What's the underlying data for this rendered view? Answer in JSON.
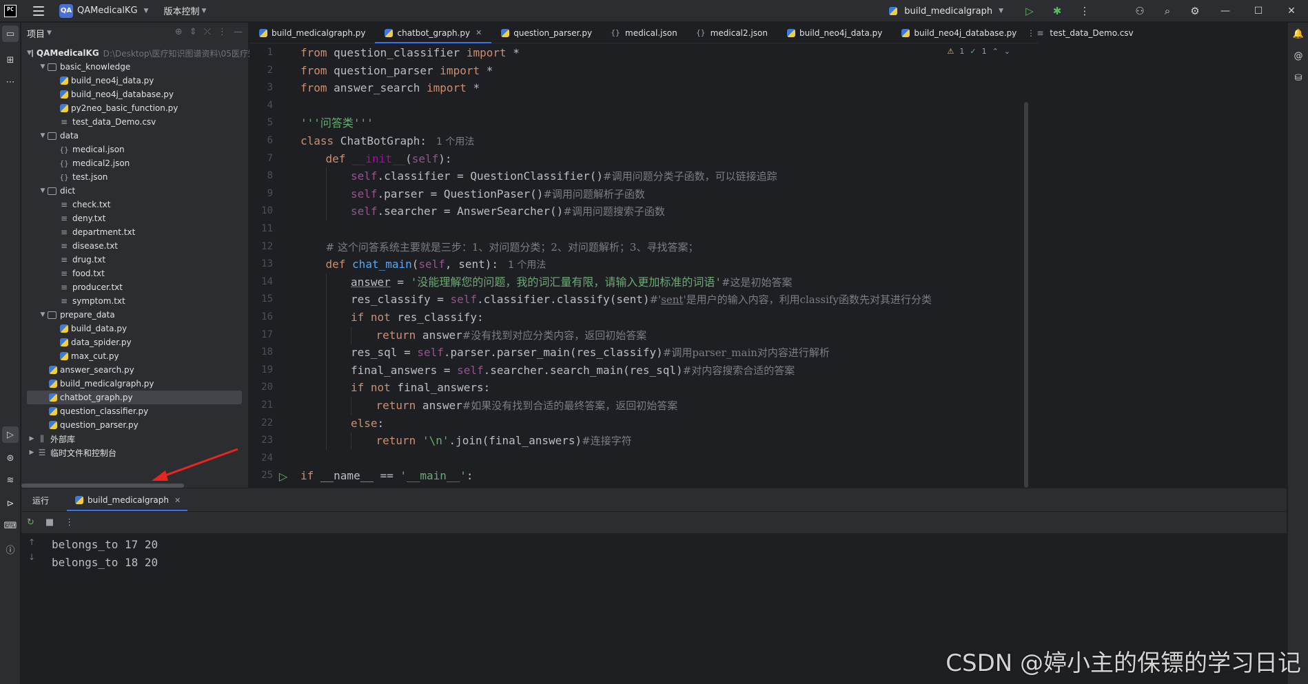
{
  "titlebar": {
    "logo": "PC",
    "project_badge": "QA",
    "project_name": "QAMedicalKG",
    "vcs_label": "版本控制",
    "run_config": "build_medicalgraph"
  },
  "project_panel": {
    "title": "项目",
    "root_name": "QAMedicalKG",
    "root_path": "D:\\Desktop\\医疗知识图谱资料\\05医疗知识图谱",
    "tree": [
      {
        "label": "basic_knowledge",
        "type": "folder",
        "depth": 1,
        "expanded": true
      },
      {
        "label": "build_neo4j_data.py",
        "type": "py",
        "depth": 2
      },
      {
        "label": "build_neo4j_database.py",
        "type": "py",
        "depth": 2
      },
      {
        "label": "py2neo_basic_function.py",
        "type": "py",
        "depth": 2
      },
      {
        "label": "test_data_Demo.csv",
        "type": "txt",
        "depth": 2
      },
      {
        "label": "data",
        "type": "folder",
        "depth": 1,
        "expanded": true
      },
      {
        "label": "medical.json",
        "type": "json",
        "depth": 2
      },
      {
        "label": "medical2.json",
        "type": "json",
        "depth": 2
      },
      {
        "label": "test.json",
        "type": "json",
        "depth": 2
      },
      {
        "label": "dict",
        "type": "folder",
        "depth": 1,
        "expanded": true
      },
      {
        "label": "check.txt",
        "type": "txt",
        "depth": 2
      },
      {
        "label": "deny.txt",
        "type": "txt",
        "depth": 2
      },
      {
        "label": "department.txt",
        "type": "txt",
        "depth": 2
      },
      {
        "label": "disease.txt",
        "type": "txt",
        "depth": 2
      },
      {
        "label": "drug.txt",
        "type": "txt",
        "depth": 2
      },
      {
        "label": "food.txt",
        "type": "txt",
        "depth": 2
      },
      {
        "label": "producer.txt",
        "type": "txt",
        "depth": 2
      },
      {
        "label": "symptom.txt",
        "type": "txt",
        "depth": 2
      },
      {
        "label": "prepare_data",
        "type": "folder",
        "depth": 1,
        "expanded": true
      },
      {
        "label": "build_data.py",
        "type": "py",
        "depth": 2
      },
      {
        "label": "data_spider.py",
        "type": "py",
        "depth": 2
      },
      {
        "label": "max_cut.py",
        "type": "py",
        "depth": 2
      },
      {
        "label": "answer_search.py",
        "type": "py",
        "depth": 1
      },
      {
        "label": "build_medicalgraph.py",
        "type": "py",
        "depth": 1
      },
      {
        "label": "chatbot_graph.py",
        "type": "py",
        "depth": 1,
        "selected": true
      },
      {
        "label": "question_classifier.py",
        "type": "py",
        "depth": 1
      },
      {
        "label": "question_parser.py",
        "type": "py",
        "depth": 1
      },
      {
        "label": "外部库",
        "type": "lib",
        "depth": 0,
        "expanded": false
      },
      {
        "label": "临时文件和控制台",
        "type": "scratch",
        "depth": 0,
        "expanded": false
      }
    ]
  },
  "tabs": [
    {
      "label": "build_medicalgraph.py",
      "type": "py"
    },
    {
      "label": "chatbot_graph.py",
      "type": "py",
      "active": true
    },
    {
      "label": "question_parser.py",
      "type": "py"
    },
    {
      "label": "medical.json",
      "type": "json"
    },
    {
      "label": "medical2.json",
      "type": "json"
    },
    {
      "label": "build_neo4j_data.py",
      "type": "py"
    },
    {
      "label": "build_neo4j_database.py",
      "type": "py"
    },
    {
      "label": "test_data_Demo.csv",
      "type": "txt"
    }
  ],
  "editor": {
    "warnings": "1",
    "checks": "1",
    "run_line": 25,
    "lines": [
      {
        "n": "1",
        "indent": 0,
        "html": "<span class='k'>from</span> question_classifier <span class='k'>import</span> *"
      },
      {
        "n": "2",
        "indent": 0,
        "html": "<span class='k'>from</span> question_parser <span class='k'>import</span> *"
      },
      {
        "n": "3",
        "indent": 0,
        "html": "<span class='k'>from</span> answer_search <span class='k'>import</span> *"
      },
      {
        "n": "4",
        "indent": 0,
        "html": ""
      },
      {
        "n": "5",
        "indent": 0,
        "html": "<span class='s'>'''问答类'''</span>"
      },
      {
        "n": "6",
        "indent": 0,
        "html": "<span class='k'>class</span> ChatBotGraph:<span class='hint'>1 个用法</span>"
      },
      {
        "n": "7",
        "indent": 1,
        "html": "<span class='k'>def</span> <span class='dn'>__init__</span>(<span class='sf'>self</span>):"
      },
      {
        "n": "8",
        "indent": 2,
        "html": "<span class='sf'>self</span>.classifier = QuestionClassifier()<span class='cm'>#调用问题分类子函数，可以链接追踪</span>"
      },
      {
        "n": "9",
        "indent": 2,
        "html": "<span class='sf'>self</span>.parser = QuestionPaser()<span class='cm'>#调用问题解析子函数</span>"
      },
      {
        "n": "10",
        "indent": 2,
        "html": "<span class='sf'>self</span>.searcher = AnswerSearcher()<span class='cm'>#调用问题搜索子函数</span>"
      },
      {
        "n": "11",
        "indent": 0,
        "html": ""
      },
      {
        "n": "12",
        "indent": 1,
        "html": "<span class='cm'># 这个问答系统主要就是三步：1、对问题分类；2、对问题解析；3、寻找答案；</span>"
      },
      {
        "n": "13",
        "indent": 1,
        "html": "<span class='k'>def</span> <span class='fn'>chat_main</span>(<span class='sf'>self</span>, sent):<span class='hint'>1 个用法</span>"
      },
      {
        "n": "14",
        "indent": 2,
        "html": "<span class='ul'>answer</span> = <span class='s'>'没能理解您的问题，我的词汇量有限，请输入更加标准的词语'</span><span class='cm'>#这是初始答案</span>"
      },
      {
        "n": "15",
        "indent": 2,
        "html": "res_classify = <span class='sf'>self</span>.classifier.classify(sent)<span class='cm'>#'<span class='ul'>sent</span>'是用户的输入内容，利用classify函数先对其进行分类</span>"
      },
      {
        "n": "16",
        "indent": 2,
        "html": "<span class='k'>if not</span> res_classify:"
      },
      {
        "n": "17",
        "indent": 3,
        "html": "<span class='k'>return</span> answer<span class='cm'>#没有找到对应分类内容，返回初始答案</span>"
      },
      {
        "n": "18",
        "indent": 2,
        "html": "res_sql = <span class='sf'>self</span>.parser.parser_main(res_classify)<span class='cm'>#调用parser_main对内容进行解析</span>"
      },
      {
        "n": "19",
        "indent": 2,
        "html": "final_answers = <span class='sf'>self</span>.searcher.search_main(res_sql)<span class='cm'>#对内容搜索合适的答案</span>"
      },
      {
        "n": "20",
        "indent": 2,
        "html": "<span class='k'>if not</span> final_answers:"
      },
      {
        "n": "21",
        "indent": 3,
        "html": "<span class='k'>return</span> answer<span class='cm'>#如果没有找到合适的最终答案，返回初始答案</span>"
      },
      {
        "n": "22",
        "indent": 2,
        "html": "<span class='k'>else</span>:"
      },
      {
        "n": "23",
        "indent": 3,
        "html": "<span class='k'>return</span> <span class='s'>'\\n'</span>.join(final_answers)<span class='cm'>#连接字符</span>"
      },
      {
        "n": "24",
        "indent": 0,
        "html": ""
      },
      {
        "n": "25",
        "indent": 0,
        "html": "<span class='k'>if</span> __name__ == <span class='s'>'__main__'</span>:"
      }
    ]
  },
  "run_panel": {
    "title": "运行",
    "tab_label": "build_medicalgraph",
    "output": [
      "belongs_to 17 20",
      "belongs_to 18 20"
    ]
  },
  "watermark": "CSDN @婷小主的保镖的学习日记",
  "colors": {
    "accent": "#3574f0",
    "annotation_arrow": "#e8261e"
  }
}
